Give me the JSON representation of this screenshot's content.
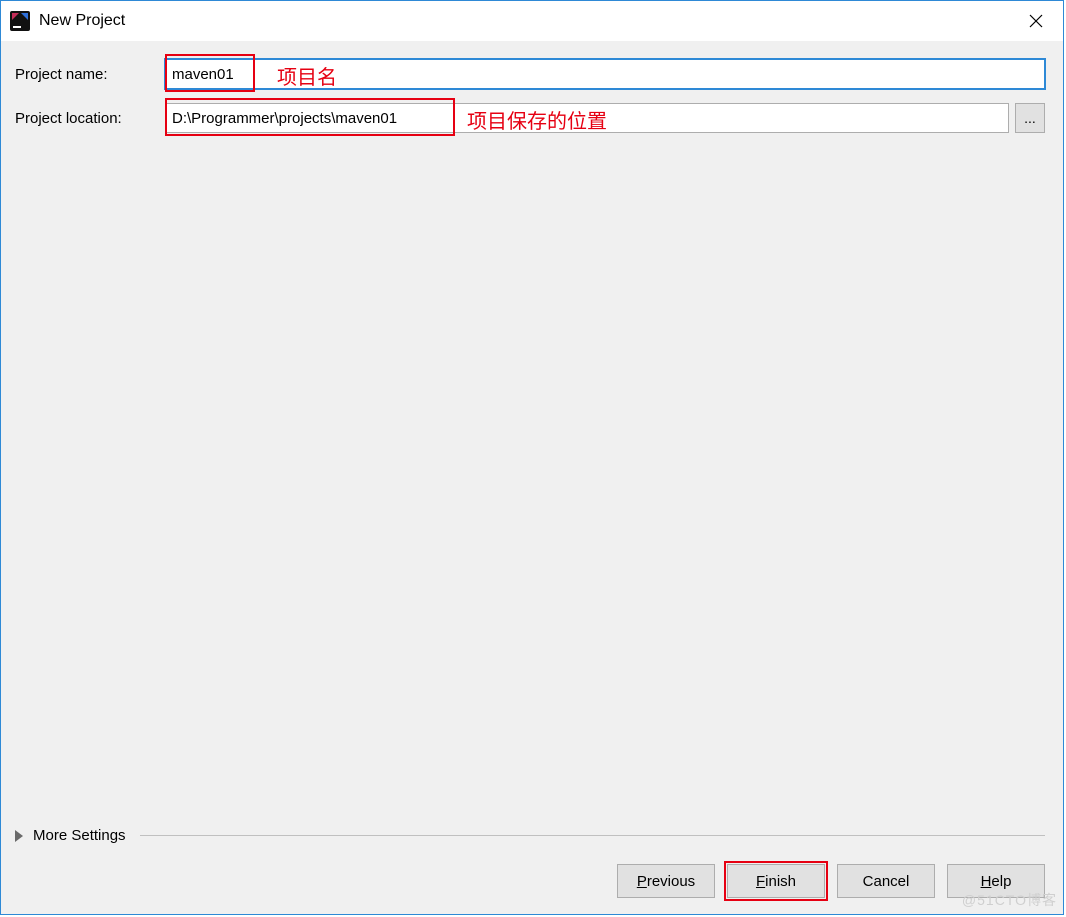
{
  "window": {
    "title": "New Project"
  },
  "form": {
    "name_label": "Project name:",
    "name_value": "maven01",
    "location_label": "Project location:",
    "location_value": "D:\\Programmer\\projects\\maven01",
    "browse_button": "..."
  },
  "annotations": {
    "name_note": "项目名",
    "location_note": "项目保存的位置"
  },
  "more_settings": {
    "label": "More Settings"
  },
  "buttons": {
    "previous": "Previous",
    "finish": "Finish",
    "cancel": "Cancel",
    "help": "Help"
  },
  "watermark": "@51CTO博客"
}
